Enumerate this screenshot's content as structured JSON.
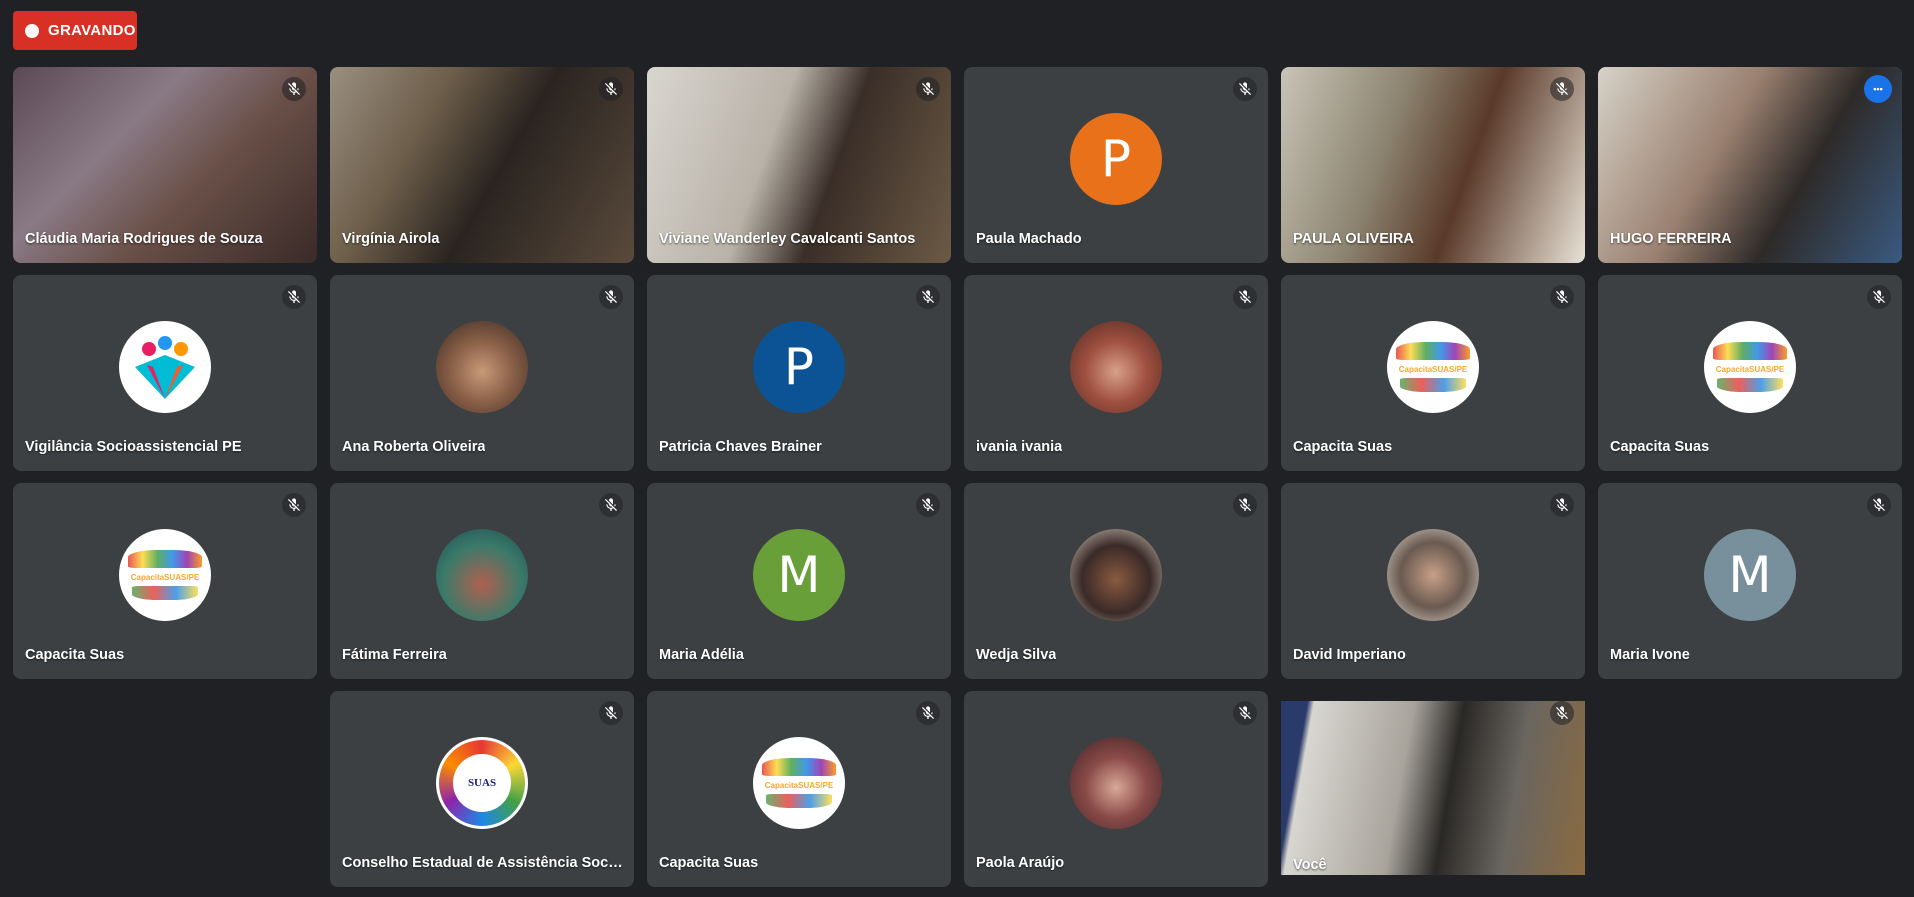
{
  "recording": {
    "label": "GRAVANDO",
    "color": "#d93025"
  },
  "accent": "#8ab4f8",
  "tile_bg": "#3c4043",
  "participants": [
    {
      "name": "Cláudia Maria Rodrigues de Souza",
      "type": "video",
      "muted": true
    },
    {
      "name": "Virgínia Airola",
      "type": "video",
      "muted": true
    },
    {
      "name": "Viviane Wanderley Cavalcanti Santos",
      "type": "video",
      "muted": true
    },
    {
      "name": "Paula Machado",
      "type": "letter",
      "initial": "P",
      "color": "#e8711a",
      "muted": true
    },
    {
      "name": "PAULA OLIVEIRA",
      "type": "video",
      "muted": true
    },
    {
      "name": "HUGO FERREIRA",
      "type": "video",
      "active_speaker": true,
      "more_icon": "more-horiz-icon"
    },
    {
      "name": "Vigilância Socioassistencial PE",
      "type": "image",
      "icon": "people-logo-icon",
      "muted": true
    },
    {
      "name": "Ana Roberta Oliveira",
      "type": "image",
      "icon": "profile-photo",
      "muted": true
    },
    {
      "name": "Patricia Chaves Brainer",
      "type": "letter",
      "initial": "P",
      "color": "#0b5394",
      "muted": true
    },
    {
      "name": "ivania ivania",
      "type": "image",
      "icon": "profile-photo",
      "muted": true
    },
    {
      "name": "Capacita Suas",
      "type": "image",
      "icon": "capacita-suas-logo",
      "logo_text": "CapacitaSUAS/PE",
      "muted": true
    },
    {
      "name": "Capacita Suas",
      "type": "image",
      "icon": "capacita-suas-logo",
      "logo_text": "CapacitaSUAS/PE",
      "muted": true
    },
    {
      "name": "Capacita Suas",
      "type": "image",
      "icon": "capacita-suas-logo",
      "logo_text": "CapacitaSUAS/PE",
      "muted": true
    },
    {
      "name": "Fátima Ferreira",
      "type": "image",
      "icon": "profile-photo",
      "muted": true
    },
    {
      "name": "Maria Adélia",
      "type": "letter",
      "initial": "M",
      "color": "#689f38",
      "muted": true
    },
    {
      "name": "Wedja Silva",
      "type": "image",
      "icon": "profile-photo",
      "muted": true
    },
    {
      "name": "David Imperiano",
      "type": "image",
      "icon": "profile-photo",
      "muted": true
    },
    {
      "name": "Maria Ivone",
      "type": "letter",
      "initial": "M",
      "color": "#78909c",
      "muted": true
    },
    {
      "name": "Conselho Estadual de Assistência Social ...",
      "type": "image",
      "icon": "suas-logo",
      "logo_text": "SUAS",
      "muted": true
    },
    {
      "name": "Capacita Suas",
      "type": "image",
      "icon": "capacita-suas-logo",
      "logo_text": "CapacitaSUAS/PE",
      "muted": true
    },
    {
      "name": "Paola Araújo",
      "type": "image",
      "icon": "profile-photo",
      "muted": true
    },
    {
      "name": "Você",
      "type": "video",
      "self": true,
      "muted": true
    }
  ]
}
